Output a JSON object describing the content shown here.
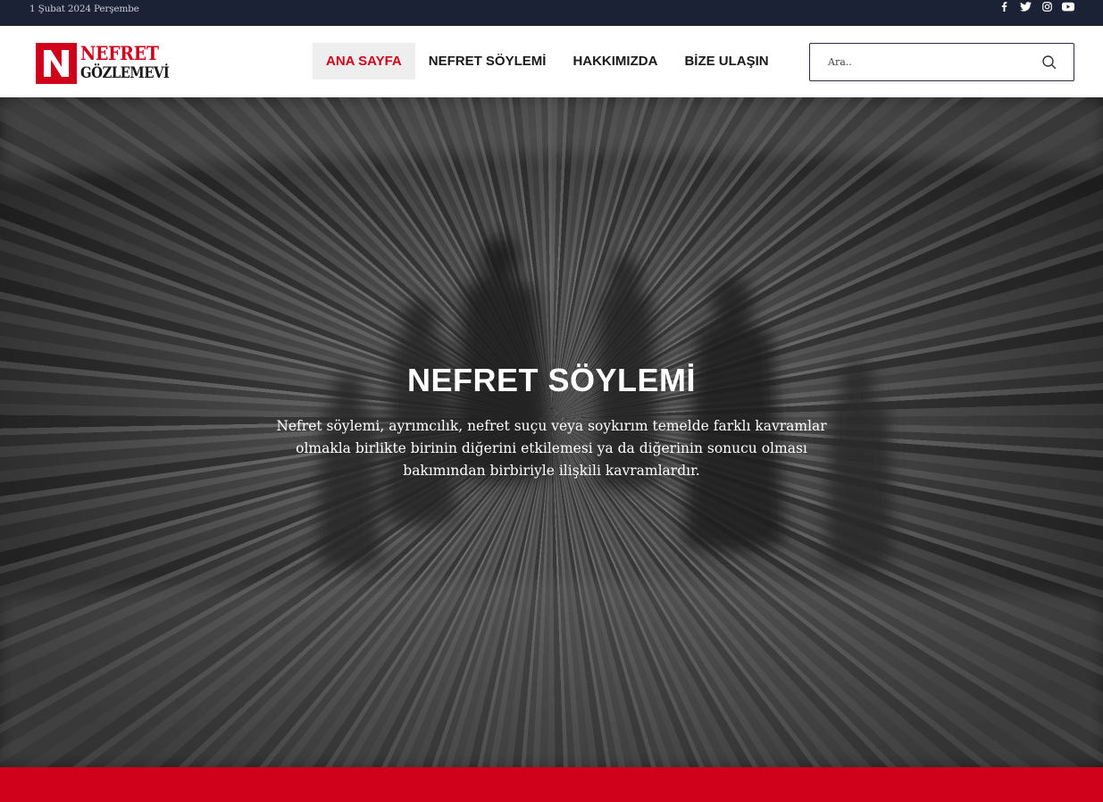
{
  "topbar": {
    "date": "1 Şubat 2024 Perşembe",
    "social": [
      "facebook-icon",
      "twitter-icon",
      "instagram-icon",
      "youtube-icon"
    ]
  },
  "logo": {
    "line1": "NEFRET",
    "line2": "GÖZLEMEVİ",
    "badge_letter": "N"
  },
  "nav": {
    "items": [
      {
        "label": "ANA SAYFA",
        "active": true
      },
      {
        "label": "NEFRET SÖYLEMİ",
        "active": false
      },
      {
        "label": "HAKKIMIZDA",
        "active": false
      },
      {
        "label": "BİZE ULAŞIN",
        "active": false
      }
    ]
  },
  "search": {
    "placeholder": "Ara..",
    "value": ""
  },
  "hero": {
    "title": "NEFRET SÖYLEMİ",
    "description": "Nefret söylemi, ayrımcılık, nefret suçu veya soykırım temelde farklı kavramlar olmakla birlikte birinin diğerini etkilemesi ya da diğerinin sonucu olması bakımından birbiriyle ilişkili kavramlardır."
  },
  "colors": {
    "brand_red": "#d0021b",
    "topbar_navy": "#1c2236"
  }
}
